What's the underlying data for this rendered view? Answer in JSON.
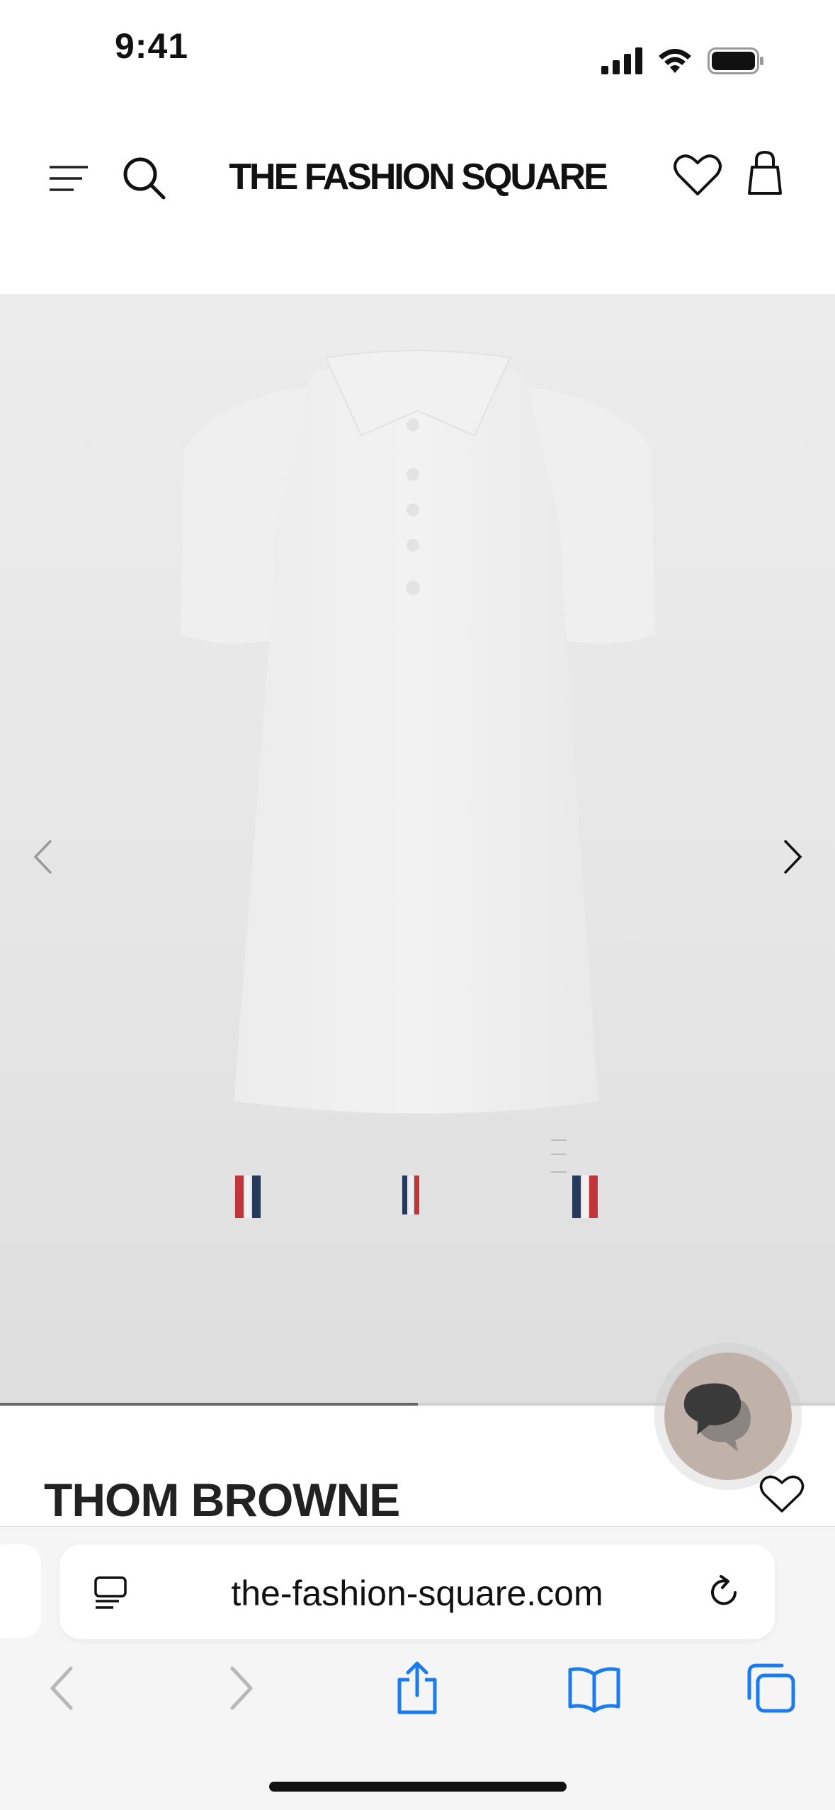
{
  "status": {
    "time": "9:41"
  },
  "header": {
    "logo": "THE FASHION SQUARE",
    "icons": [
      "hamburger-icon",
      "search-icon",
      "heart-icon",
      "user-icon"
    ]
  },
  "gallery": {
    "progress": 0.5,
    "icons": [
      "chevron-left-icon",
      "chevron-right-icon"
    ]
  },
  "product": {
    "brand": "THOM BROWNE"
  },
  "browser": {
    "url": "the-fashion-square.com",
    "toolbar_icons": [
      "back-icon",
      "forward-icon",
      "share-icon",
      "bookmarks-icon",
      "tabs-icon"
    ],
    "accent_color": "#1a7cf0"
  },
  "colors": {
    "chat_button": "#c1b2a9",
    "background": "#ffffff"
  }
}
